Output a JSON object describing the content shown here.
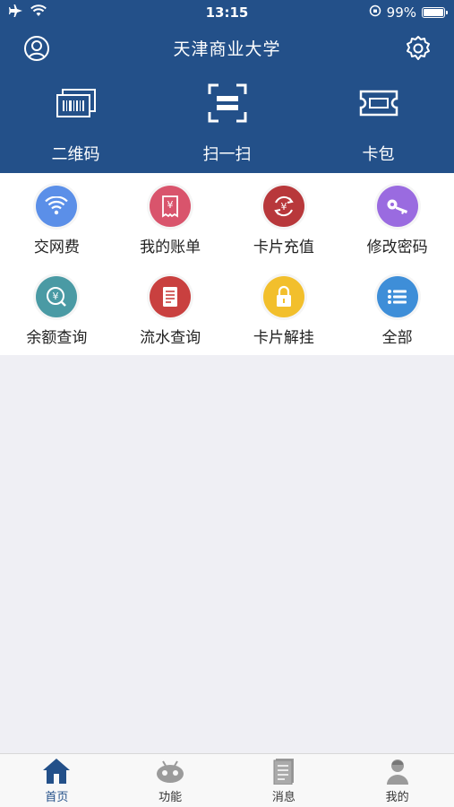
{
  "status_bar": {
    "time": "13:15",
    "battery": "99%"
  },
  "header": {
    "title": "天津商业大学",
    "quick_actions": [
      {
        "label": "二维码",
        "icon": "barcode-card-icon"
      },
      {
        "label": "扫一扫",
        "icon": "scan-icon"
      },
      {
        "label": "卡包",
        "icon": "ticket-icon"
      }
    ]
  },
  "grid": [
    {
      "label": "交网费",
      "icon": "wifi-icon",
      "color": "#5b8fe8"
    },
    {
      "label": "我的账单",
      "icon": "receipt-icon",
      "color": "#d9546c"
    },
    {
      "label": "卡片充值",
      "icon": "recharge-icon",
      "color": "#b8383b"
    },
    {
      "label": "修改密码",
      "icon": "key-icon",
      "color": "#9a6be0"
    },
    {
      "label": "余额查询",
      "icon": "balance-icon",
      "color": "#4a9aa4"
    },
    {
      "label": "流水查询",
      "icon": "statement-icon",
      "color": "#c9403f"
    },
    {
      "label": "卡片解挂",
      "icon": "unlock-icon",
      "color": "#f2bf2c"
    },
    {
      "label": "全部",
      "icon": "list-icon",
      "color": "#3e8ed8"
    }
  ],
  "tabbar": [
    {
      "label": "首页",
      "icon": "home-icon",
      "active": true
    },
    {
      "label": "功能",
      "icon": "robot-icon",
      "active": false
    },
    {
      "label": "消息",
      "icon": "message-icon",
      "active": false
    },
    {
      "label": "我的",
      "icon": "profile-icon",
      "active": false
    }
  ],
  "colors": {
    "primary": "#235089",
    "background": "#efeff4"
  }
}
